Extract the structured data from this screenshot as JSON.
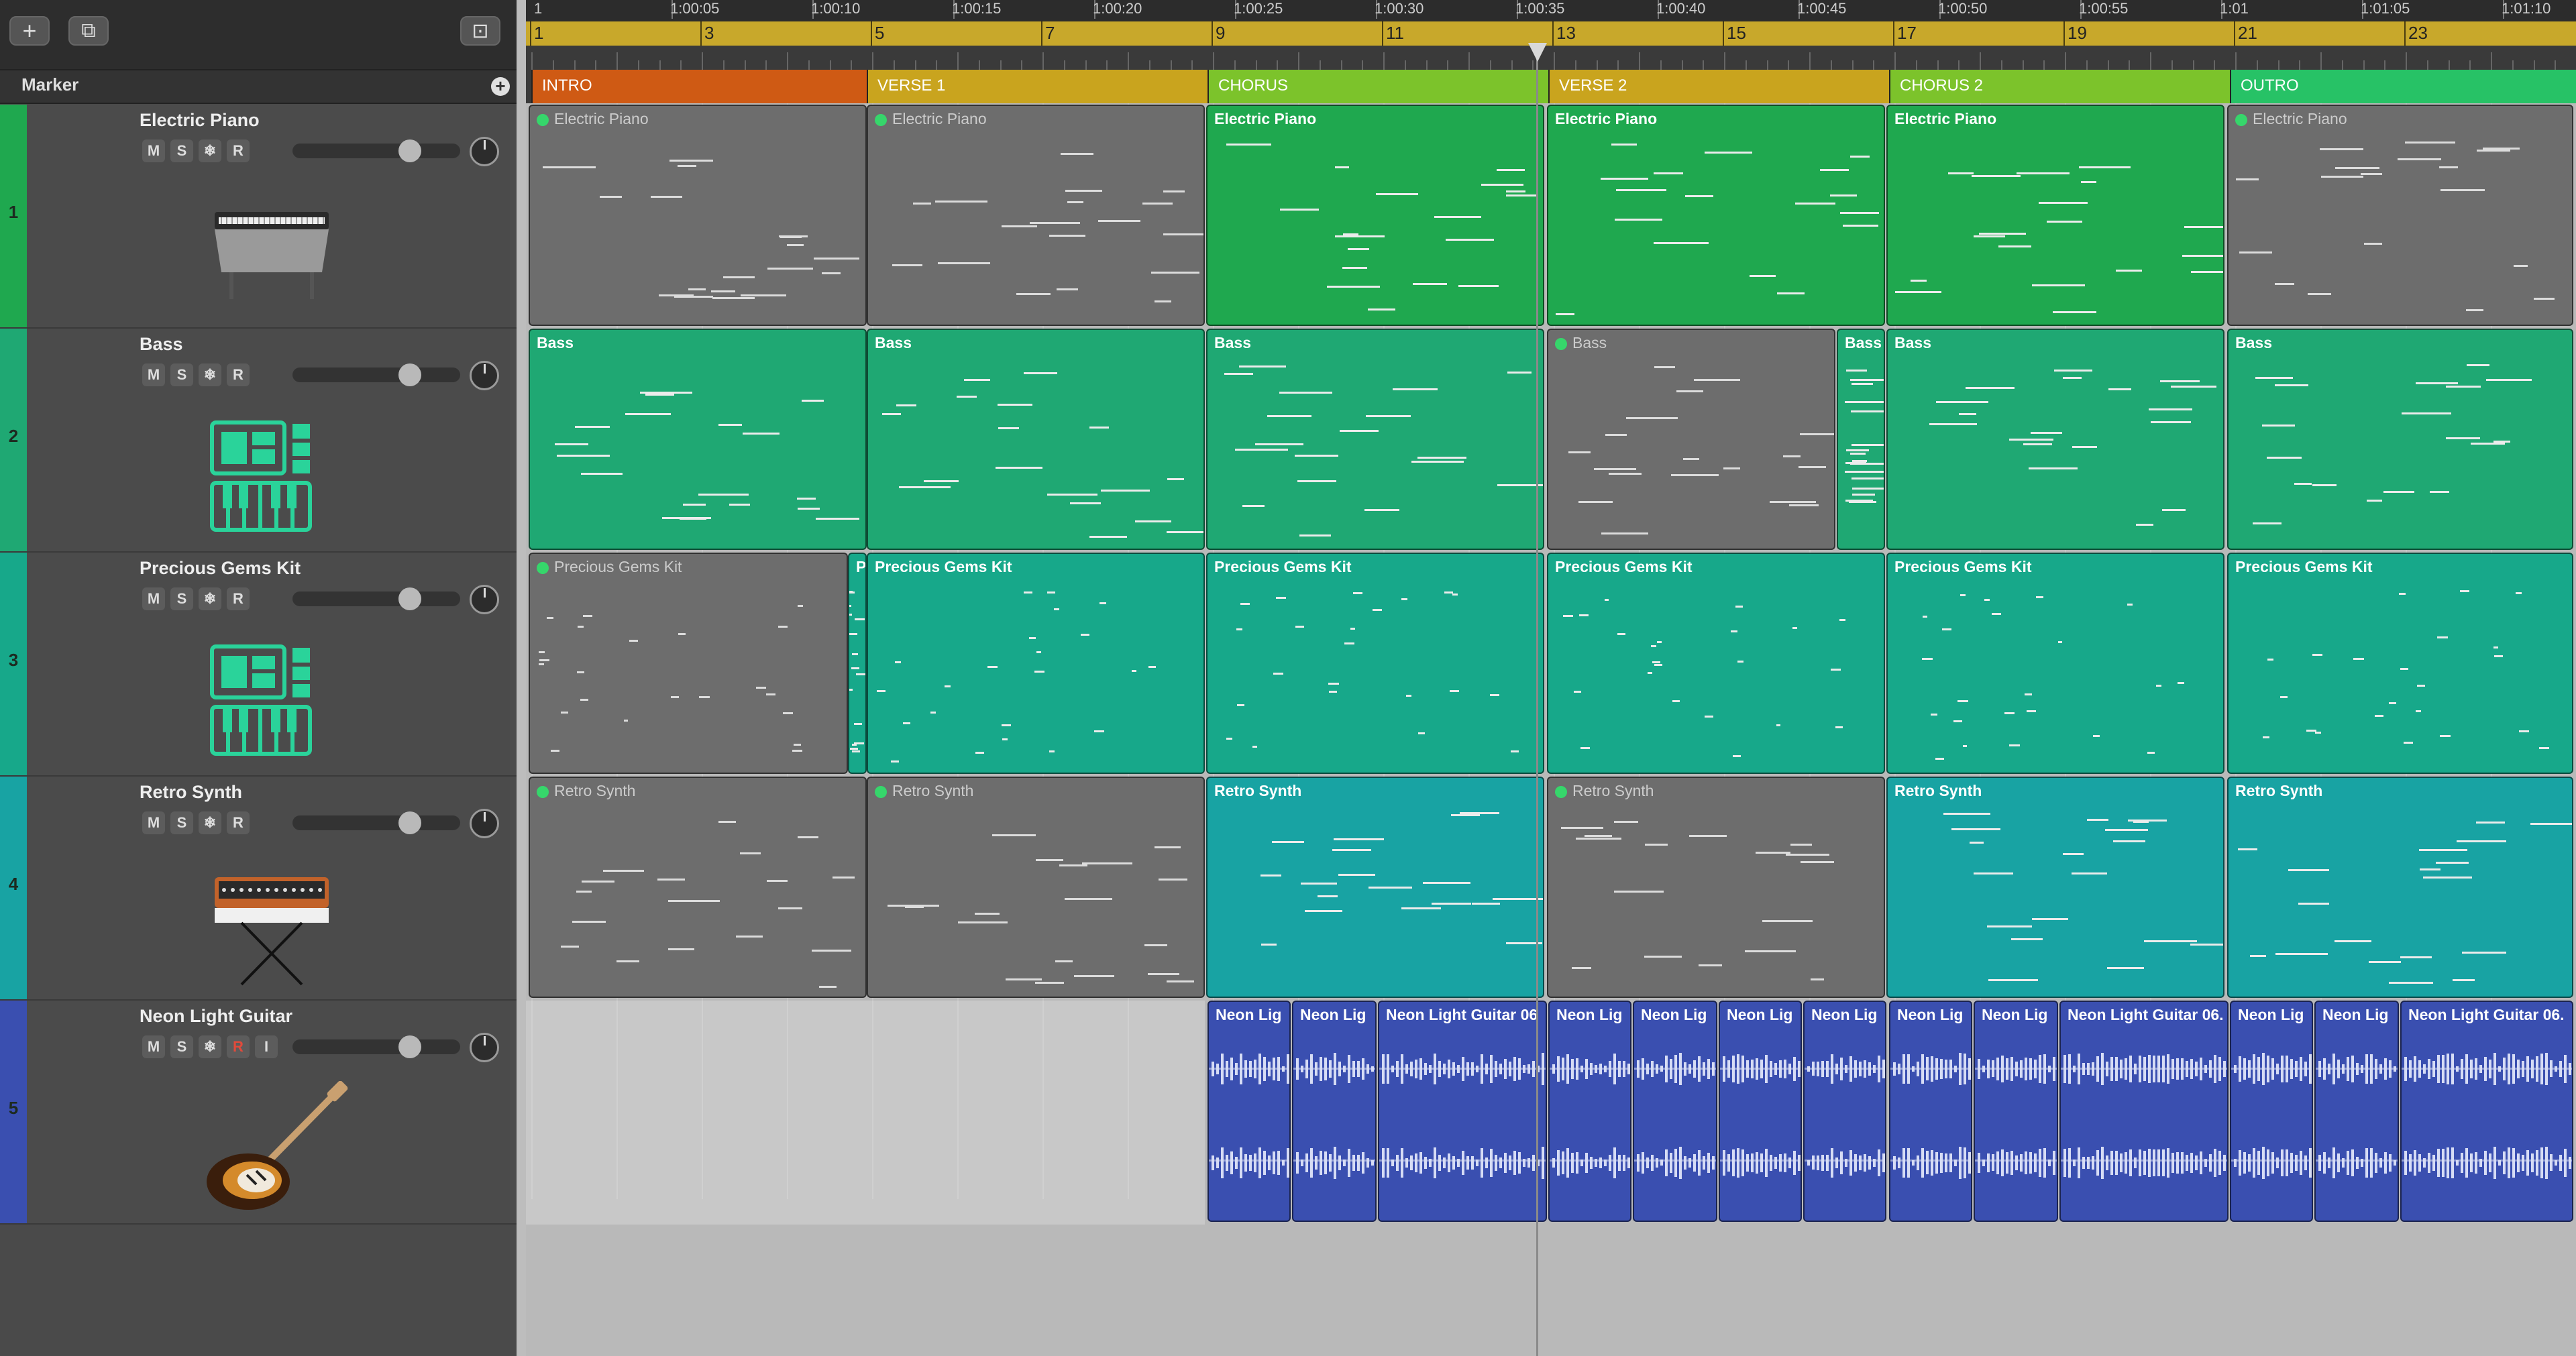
{
  "toolbar": {
    "add_icon": "+",
    "duplicate_icon": "⧉",
    "track_icon": "⊡"
  },
  "marker_header": {
    "label": "Marker"
  },
  "timeline": {
    "times": [
      "1:00:05",
      "1:00:10",
      "1:00:15",
      "1:00:20",
      "1:00:25",
      "1:00:30",
      "1:00:35",
      "1:00:40",
      "1:00:45",
      "1:00:50",
      "1:00:55",
      "1:01",
      "1:01:05",
      "1:01:10"
    ],
    "ruler_start": "1",
    "bars": [
      "1",
      "3",
      "5",
      "7",
      "9",
      "11",
      "13",
      "15",
      "17",
      "19",
      "21",
      "23"
    ]
  },
  "markers": [
    "INTRO",
    "VERSE 1",
    "CHORUS",
    "VERSE 2",
    "CHORUS 2",
    "OUTRO"
  ],
  "tracks": [
    {
      "number": "1",
      "name": "Electric Piano",
      "buttons": [
        "M",
        "S",
        "❄",
        "R"
      ],
      "color": "#1fa84f",
      "instrument": "electric-piano-image"
    },
    {
      "number": "2",
      "name": "Bass",
      "buttons": [
        "M",
        "S",
        "❄",
        "R"
      ],
      "color": "#1fa873",
      "instrument": "drum-machine-icon"
    },
    {
      "number": "3",
      "name": "Precious Gems Kit",
      "buttons": [
        "M",
        "S",
        "❄",
        "R"
      ],
      "color": "#17a88a",
      "instrument": "drum-machine-icon"
    },
    {
      "number": "4",
      "name": "Retro Synth",
      "buttons": [
        "M",
        "S",
        "❄",
        "R"
      ],
      "color": "#18a3a3",
      "instrument": "synthesizer-image"
    },
    {
      "number": "5",
      "name": "Neon Light Guitar",
      "buttons": [
        "M",
        "S",
        "❄",
        "R",
        "I"
      ],
      "color": "#3a4fb0",
      "instrument": "electric-guitar-image"
    }
  ],
  "regions": {
    "electric_piano": [
      "Electric Piano",
      "Electric Piano",
      "Electric Piano",
      "Electric Piano",
      "Electric Piano",
      "Electric Piano"
    ],
    "bass": [
      "Bass",
      "Bass",
      "Bass",
      "Bass",
      "Bass",
      "Bass",
      "Bass"
    ],
    "kit": [
      "Precious Gems Kit",
      "P",
      "Precious Gems Kit",
      "Precious Gems Kit",
      "Precious Gems Kit",
      "Precious Gems Kit",
      "Precious Gems Kit"
    ],
    "synth": [
      "Retro Synth",
      "Retro Synth",
      "Retro Synth",
      "Retro Synth",
      "Retro Synth",
      "Retro Synth"
    ],
    "guitar": [
      "Neon Lig",
      "Neon Lig",
      "Neon Light Guitar 06",
      "Neon Lig",
      "Neon Lig",
      "Neon Lig",
      "Neon Lig",
      "Neon Lig",
      "Neon Lig",
      "Neon Light Guitar 06.",
      "Neon Lig",
      "Neon Lig",
      "Neon Light Guitar 06."
    ]
  },
  "colors": {
    "piano": "#1fa84f",
    "bass": "#1fa873",
    "kit": "#17a88a",
    "synth": "#18a3a3",
    "guitar": "#3a4fb0",
    "intro": "#cf5a14",
    "verse1": "#c9a41e",
    "chorus": "#7cc32b",
    "verse2": "#c9a41e",
    "chorus2": "#7cc32b",
    "outro": "#27c266"
  }
}
